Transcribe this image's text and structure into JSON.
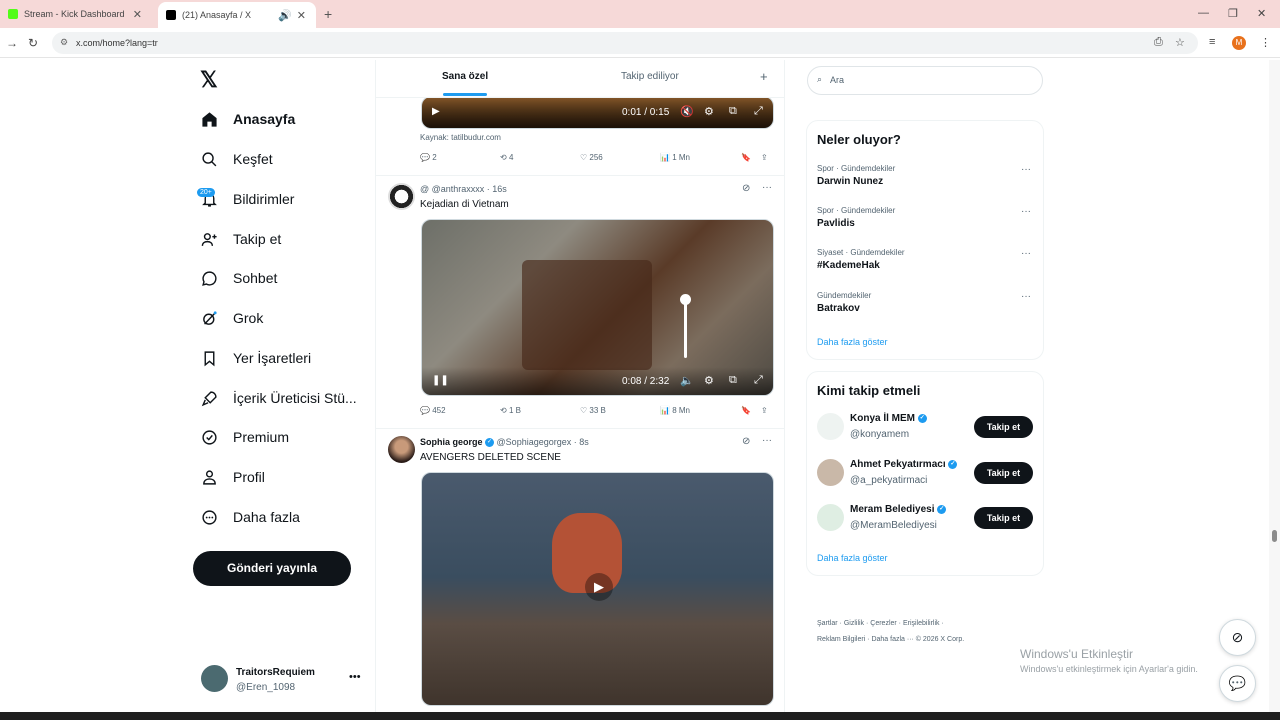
{
  "browser": {
    "tabs": [
      {
        "title": "Stream - Kick Dashboard",
        "icon": "kick-icon",
        "color": "#53fc18"
      },
      {
        "title": "(21) Anasayfa / X",
        "icon": "x-icon",
        "color": "#000000"
      }
    ],
    "url": "x.com/home?lang=tr",
    "profile_initial": "M"
  },
  "sidebar": {
    "items": [
      {
        "label": "Anasayfa",
        "icon": "home-icon"
      },
      {
        "label": "Keşfet",
        "icon": "search-icon"
      },
      {
        "label": "Bildirimler",
        "icon": "bell-icon",
        "badge": "20+"
      },
      {
        "label": "Takip et",
        "icon": "person-add-icon"
      },
      {
        "label": "Sohbet",
        "icon": "chat-icon"
      },
      {
        "label": "Grok",
        "icon": "grok-icon"
      },
      {
        "label": "Yer İşaretleri",
        "icon": "bookmark-icon"
      },
      {
        "label": "İçerik Üreticisi Stü...",
        "icon": "rocket-icon"
      },
      {
        "label": "Premium",
        "icon": "premium-icon"
      },
      {
        "label": "Profil",
        "icon": "profile-icon"
      },
      {
        "label": "Daha fazla",
        "icon": "more-circle-icon"
      }
    ],
    "post_button": "Gönderi yayınla",
    "account": {
      "name": "TraitorsRequiem",
      "handle": "@Eren_1098"
    }
  },
  "feed": {
    "tabs": [
      "Sana özel",
      "Takip ediliyor"
    ],
    "post1": {
      "time": "0:01 / 0:15",
      "source": "Kaynak: tatilbudur.com",
      "replies": "2",
      "reposts": "4",
      "likes": "256",
      "views": "1 Mn"
    },
    "post2": {
      "handle": "@ @anthraxxxx · 16s",
      "text": "Kejadian di Vietnam",
      "time": "0:08 / 2:32",
      "replies": "452",
      "reposts": "1 B",
      "likes": "33 B",
      "views": "8 Mn"
    },
    "post3": {
      "name": "Sophia george",
      "handle": "@Sophiagegorgex · 8s",
      "text": "AVENGERS DELETED SCENE"
    }
  },
  "right": {
    "search_placeholder": "Ara",
    "trends_title": "Neler oluyor?",
    "trends": [
      {
        "category": "Spor · Gündemdekiler",
        "name": "Darwin Nunez"
      },
      {
        "category": "Spor · Gündemdekiler",
        "name": "Pavlidis"
      },
      {
        "category": "Siyaset · Gündemdekiler",
        "name": "#KademeHak"
      },
      {
        "category": "Gündemdekiler",
        "name": "Batrakov"
      }
    ],
    "show_more": "Daha fazla göster",
    "who_title": "Kimi takip etmeli",
    "who": [
      {
        "name": "Konya İl MEM",
        "handle": "@konyamem"
      },
      {
        "name": "Ahmet Pekyatırmacı",
        "handle": "@a_pekyatirmaci"
      },
      {
        "name": "Meram Belediyesi",
        "handle": "@MeramBelediyesi"
      }
    ],
    "follow_label": "Takip et",
    "footer1": "Şartlar · Gizlilik · Çerezler · Erişilebilirlik ·",
    "footer2": "Reklam Bilgileri · Daha fazla ··· © 2026 X Corp."
  },
  "windows": {
    "activate_title": "Windows'u Etkinleştir",
    "activate_sub": "Windows'u etkinleştirmek için Ayarlar'a gidin."
  }
}
